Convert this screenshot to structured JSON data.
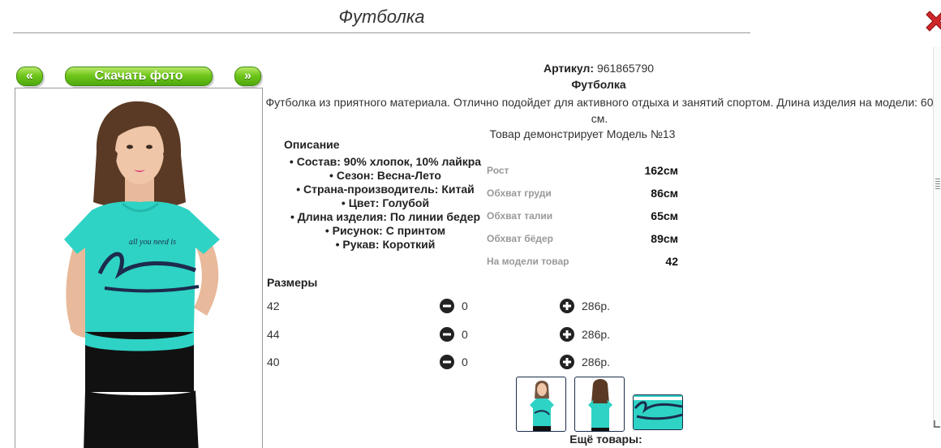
{
  "page": {
    "title": "Футболка"
  },
  "nav": {
    "prev_label": "«",
    "download_label": "Скачать фото",
    "next_label": "»"
  },
  "product": {
    "article_label": "Артикул:",
    "article_value": "961865790",
    "name": "Футболка",
    "description": "Футболка из приятного материала. Отлично подойдет для активного отдыха и занятий спортом. Длина изделия на модели: 60 см.",
    "model_line": "Товар демонстрирует Модель №13"
  },
  "specs": {
    "title": "Описание",
    "items": [
      "Состав: 90% хлопок, 10% лайкра",
      "Сезон: Весна-Лето",
      "Страна-производитель: Китай",
      "Цвет: Голубой",
      "Длина изделия: По линии бедер",
      "Рисунок: С принтом",
      "Рукав: Короткий"
    ]
  },
  "model_measures": [
    {
      "label": "Рост",
      "value": "162см"
    },
    {
      "label": "Обхват груди",
      "value": "86см"
    },
    {
      "label": "Обхват талии",
      "value": "65см"
    },
    {
      "label": "Обхват бёдер",
      "value": "89см"
    },
    {
      "label": "На модели товар",
      "value": "42"
    }
  ],
  "sizes": {
    "title": "Размеры",
    "rows": [
      {
        "size": "42",
        "qty": "0",
        "price": "286р."
      },
      {
        "size": "44",
        "qty": "0",
        "price": "286р."
      },
      {
        "size": "40",
        "qty": "0",
        "price": "286р."
      }
    ]
  },
  "more_label": "Ещё товары:",
  "colors": {
    "accent_green": "#6fc61b",
    "tshirt": "#2ed3c5",
    "close_red": "#d0262a"
  },
  "icons": {
    "close": "close-icon",
    "minus": "minus-circle-icon",
    "plus": "plus-circle-icon"
  }
}
